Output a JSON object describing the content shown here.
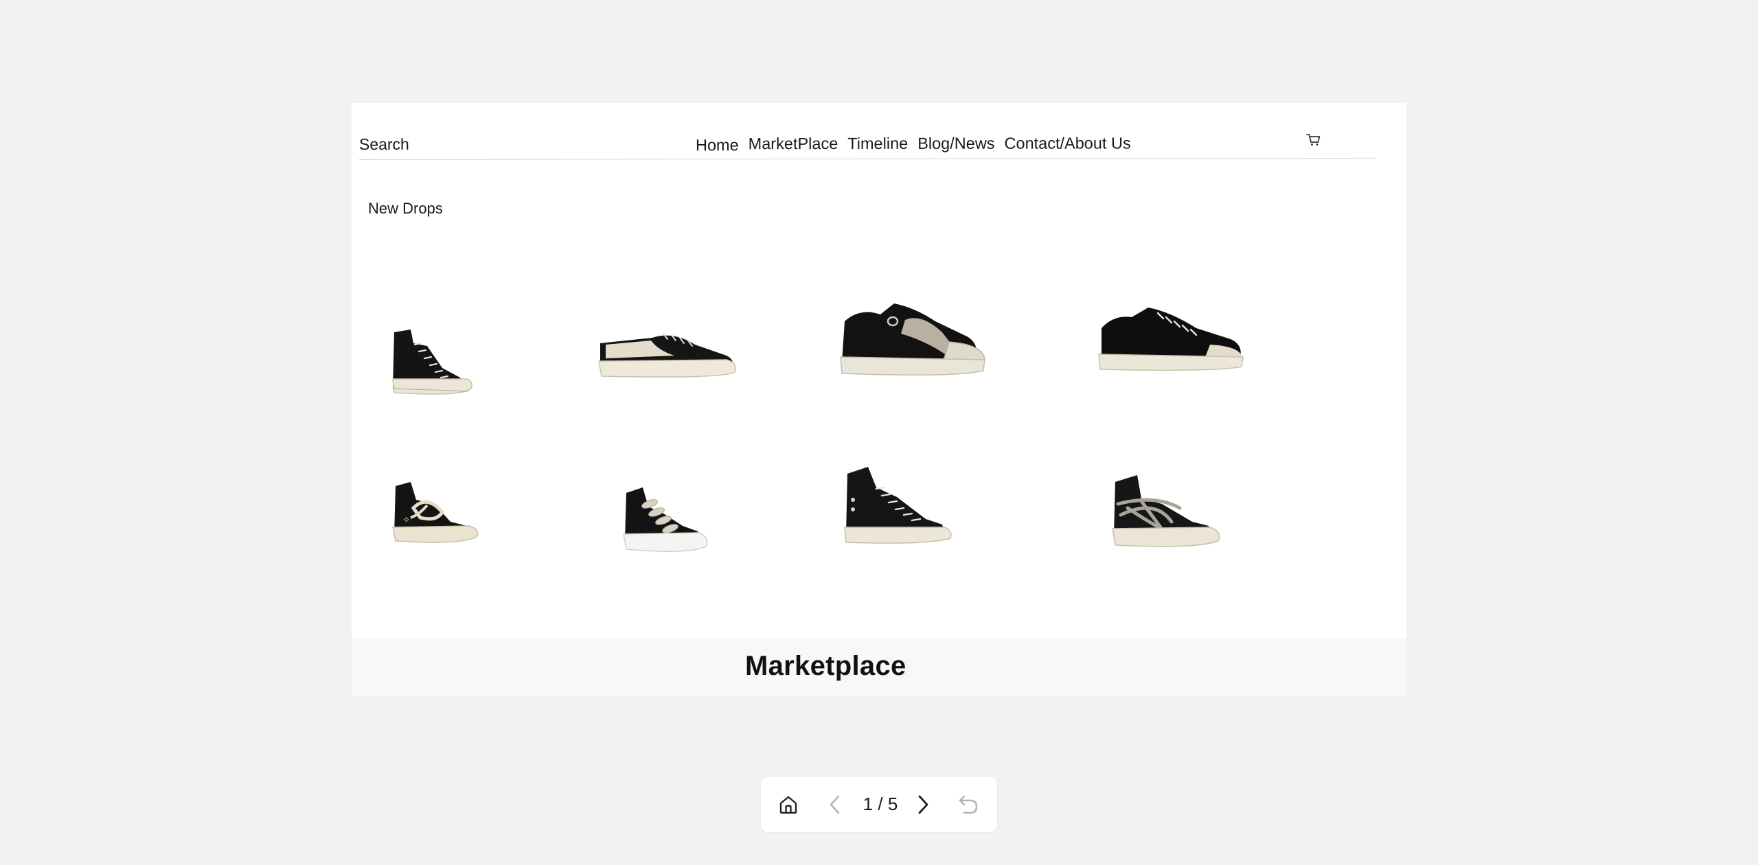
{
  "header": {
    "search_label": "Search",
    "nav": [
      "Home",
      "MarketPlace",
      "Timeline",
      "Blog/News",
      "Contact/About Us"
    ],
    "cart_icon": "cart-icon"
  },
  "main": {
    "section_title": "New Drops",
    "products": [
      {
        "style": "high-top",
        "laces": "white"
      },
      {
        "style": "low-top with cream panel",
        "laces": "white"
      },
      {
        "style": "low-top",
        "laces": "jumbo grey"
      },
      {
        "style": "low-top",
        "laces": "white"
      },
      {
        "style": "high-top",
        "laces": "cream jumbo"
      },
      {
        "style": "high-top",
        "laces": "cream jumbo"
      },
      {
        "style": "high-top",
        "laces": "white"
      },
      {
        "style": "high-top",
        "laces": "jumbo grey crossed"
      }
    ]
  },
  "footer": {
    "title": "Marketplace"
  },
  "pager": {
    "current": "1 / 5",
    "home_icon": "home-icon",
    "prev_icon": "chevron-left-icon",
    "next_icon": "chevron-right-icon",
    "undo_icon": "undo-icon"
  },
  "colors": {
    "background": "#f2f2f2",
    "card": "#ffffff",
    "shoe_canvas": "#111111",
    "sole": "#e9e3d3"
  }
}
